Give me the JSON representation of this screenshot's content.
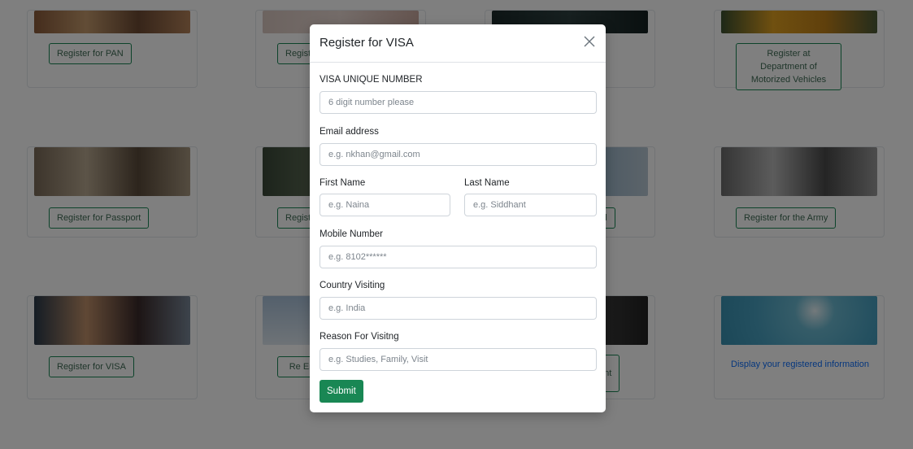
{
  "background_cards": {
    "pan_button": "Register for PAN",
    "partial_top_button": "Regist",
    "dmv_button": "Register at Department of Motorized Vehicles",
    "passport_button": "Register for Passport",
    "partial_mid_button": "Regist",
    "partial_mid_right_button": "rd",
    "army_button": "Register for the Army",
    "visa_button": "Register for VISA",
    "partial_bottom_button": "Re En",
    "partial_bottom_right_button": "ent",
    "display_info_link": "Display your registered information"
  },
  "modal": {
    "title": "Register for VISA",
    "visa_number": {
      "label": "VISA UNIQUE NUMBER",
      "placeholder": "6 digit number please",
      "value": ""
    },
    "email": {
      "label": "Email address",
      "placeholder": "e.g. nkhan@gmail.com",
      "value": ""
    },
    "first_name": {
      "label": "First Name",
      "placeholder": "e.g. Naina",
      "value": ""
    },
    "last_name": {
      "label": "Last Name",
      "placeholder": "e.g. Siddhant",
      "value": ""
    },
    "mobile": {
      "label": "Mobile Number",
      "placeholder": "e.g. 8102******",
      "value": ""
    },
    "country": {
      "label": "Country Visiting",
      "placeholder": "e.g. India",
      "value": ""
    },
    "reason": {
      "label": "Reason For Visitng",
      "placeholder": "e.g. Studies, Family, Visit",
      "value": ""
    },
    "submit_label": "Submit"
  },
  "colors": {
    "success_green": "#198754",
    "link_blue": "#0d6efd",
    "backdrop": "rgba(0,0,0,0.5)"
  }
}
